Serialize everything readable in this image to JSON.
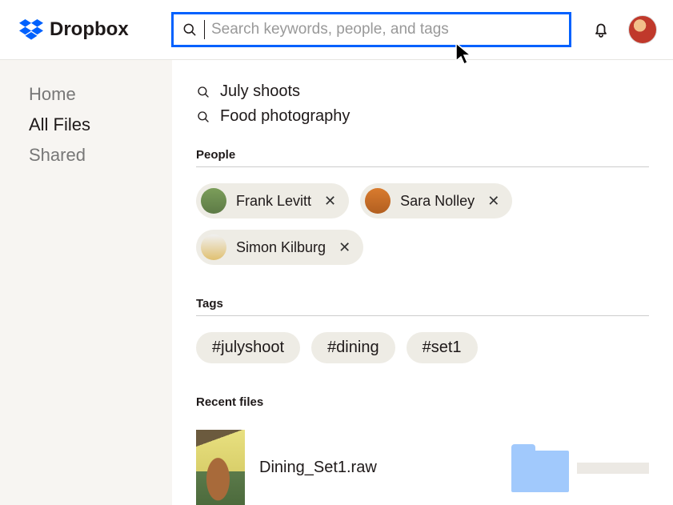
{
  "brand": {
    "name": "Dropbox"
  },
  "search": {
    "placeholder": "Search keywords, people, and tags"
  },
  "sidebar": {
    "items": [
      {
        "label": "Home"
      },
      {
        "label": "All Files"
      },
      {
        "label": "Shared"
      }
    ],
    "active_index": 1
  },
  "suggestions": [
    {
      "label": "July shoots"
    },
    {
      "label": "Food photography"
    }
  ],
  "sections": {
    "people_label": "People",
    "tags_label": "Tags",
    "recent_label": "Recent files"
  },
  "people": [
    {
      "name": "Frank Levitt",
      "avatar_color": "#7b9e5a"
    },
    {
      "name": "Sara Nolley",
      "avatar_color": "#d97b2e"
    },
    {
      "name": "Simon Kilburg",
      "avatar_color": "#e0c070"
    }
  ],
  "tags": [
    {
      "label": "#julyshoot"
    },
    {
      "label": "#dining"
    },
    {
      "label": "#set1"
    }
  ],
  "recent_files": [
    {
      "name": "Dining_Set1.raw",
      "kind": "image"
    },
    {
      "name": "",
      "kind": "folder"
    }
  ]
}
